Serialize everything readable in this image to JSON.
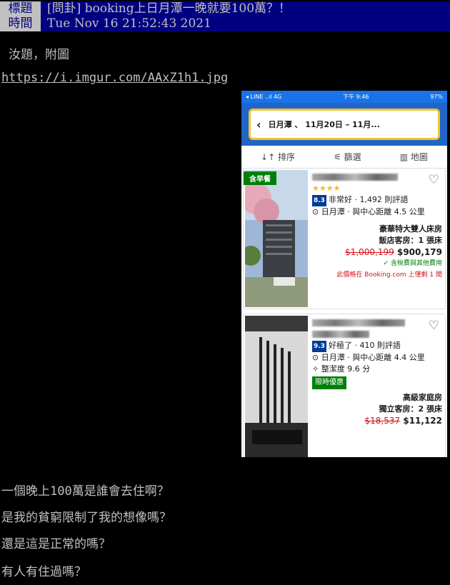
{
  "header": {
    "title_key": "標題",
    "title_value": "[問卦] booking上日月潭一晚就要100萬？！",
    "time_key": "時間",
    "time_value": "Tue Nov 16 21:52:43 2021"
  },
  "post": {
    "line1": "汝題，附圖",
    "link": "https://i.imgur.com/AAxZ1h1.jpg",
    "lines": [
      "一個晚上100萬是誰會去住啊？",
      "是我的貧窮限制了我的想像嗎？",
      "還是這是正常的嗎？",
      "有人有住過嗎？"
    ]
  },
  "phone": {
    "status_left": "◂ LINE ..ıl 4G",
    "status_center": "下午 9:46",
    "status_right": "97%",
    "search_text": "日月潭  、 11月20日 – 11月...",
    "sort_label": "↓↑ 排序",
    "filter_label": "篩選",
    "map_label": "地圖",
    "card1": {
      "badge": "含早餐",
      "stars": "★★★★",
      "score": "8.3",
      "rating_text": "非常好 · 1,492 則評語",
      "location": "日月潭 · 與中心距離 4.5 公里",
      "room": "豪華特大雙人床房",
      "room_detail": "飯店客房：1 張床",
      "old_price": "$1,000,199",
      "new_price": "$900,179",
      "tax_note": "✓ 含稅費與其他費用",
      "scarcity": "此價格在 Booking.com 上僅剩 1 間"
    },
    "card2": {
      "score": "9.3",
      "rating_text": "好極了 · 410 則評語",
      "location": "日月潭 · 與中心距離 4.4 公里",
      "clean": "整潔度 9.6 分",
      "tag": "限時優惠",
      "room": "高級家庭房",
      "room_detail": "獨立客房：2 張床",
      "old_price": "$18,537",
      "new_price": "$11,122"
    }
  }
}
